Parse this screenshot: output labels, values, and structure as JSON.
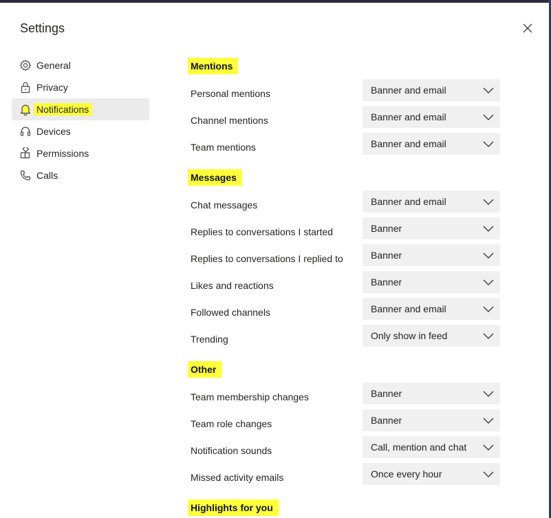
{
  "dialog": {
    "title": "Settings"
  },
  "nav": [
    {
      "label": "General",
      "icon": "gear-icon"
    },
    {
      "label": "Privacy",
      "icon": "lock-icon"
    },
    {
      "label": "Notifications",
      "icon": "bell-icon",
      "active": true
    },
    {
      "label": "Devices",
      "icon": "headset-icon"
    },
    {
      "label": "Permissions",
      "icon": "apps-icon"
    },
    {
      "label": "Calls",
      "icon": "phone-icon"
    }
  ],
  "sections": {
    "mentions": {
      "title": "Mentions",
      "rows": [
        {
          "label": "Personal mentions",
          "value": "Banner and email"
        },
        {
          "label": "Channel mentions",
          "value": "Banner and email"
        },
        {
          "label": "Team mentions",
          "value": "Banner and email"
        }
      ]
    },
    "messages": {
      "title": "Messages",
      "rows": [
        {
          "label": "Chat messages",
          "value": "Banner and email"
        },
        {
          "label": "Replies to conversations I started",
          "value": "Banner"
        },
        {
          "label": "Replies to conversations I replied to",
          "value": "Banner"
        },
        {
          "label": "Likes and reactions",
          "value": "Banner"
        },
        {
          "label": "Followed channels",
          "value": "Banner and email"
        },
        {
          "label": "Trending",
          "value": "Only show in feed"
        }
      ]
    },
    "other": {
      "title": "Other",
      "rows": [
        {
          "label": "Team membership changes",
          "value": "Banner"
        },
        {
          "label": "Team role changes",
          "value": "Banner"
        },
        {
          "label": "Notification sounds",
          "value": "Call, mention and chat"
        },
        {
          "label": "Missed activity emails",
          "value": "Once every hour"
        }
      ]
    },
    "highlights": {
      "title": "Highlights for you"
    }
  },
  "colors": {
    "highlight": "#ffff3a",
    "dropdown_bg": "#f0f0f0",
    "nav_active_bg": "#ebebeb"
  }
}
